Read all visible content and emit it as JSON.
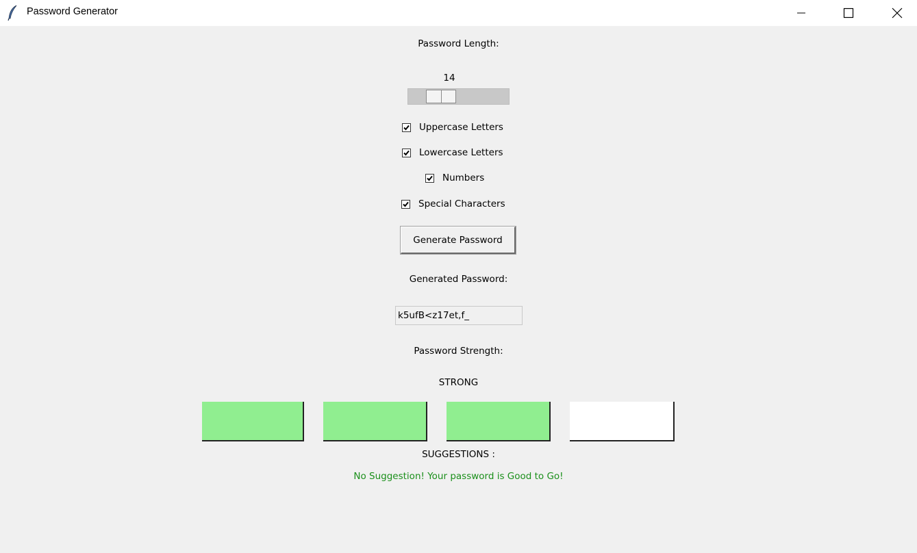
{
  "window": {
    "title": "Password Generator",
    "app_icon": "feather-icon"
  },
  "length": {
    "label": "Password Length:",
    "value": "14",
    "min": 8,
    "max": 32
  },
  "options": [
    {
      "label": "Uppercase Letters",
      "checked": true
    },
    {
      "label": "Lowercase Letters",
      "checked": true
    },
    {
      "label": "Numbers",
      "checked": true
    },
    {
      "label": "Special Characters",
      "checked": true
    }
  ],
  "generate_button_label": "Generate Password",
  "generated": {
    "label": "Generated Password:",
    "value": "k5ufB<z17et,f_"
  },
  "strength": {
    "label": "Password Strength:",
    "value": "STRONG",
    "bars": [
      {
        "filled": true,
        "color": "#90ee90"
      },
      {
        "filled": true,
        "color": "#90ee90"
      },
      {
        "filled": true,
        "color": "#90ee90"
      },
      {
        "filled": false,
        "color": "#ffffff"
      }
    ]
  },
  "suggestions": {
    "label": "SUGGESTIONS :",
    "text": "No Suggestion! Your password is Good to Go!",
    "color": "#1a8f1a"
  }
}
